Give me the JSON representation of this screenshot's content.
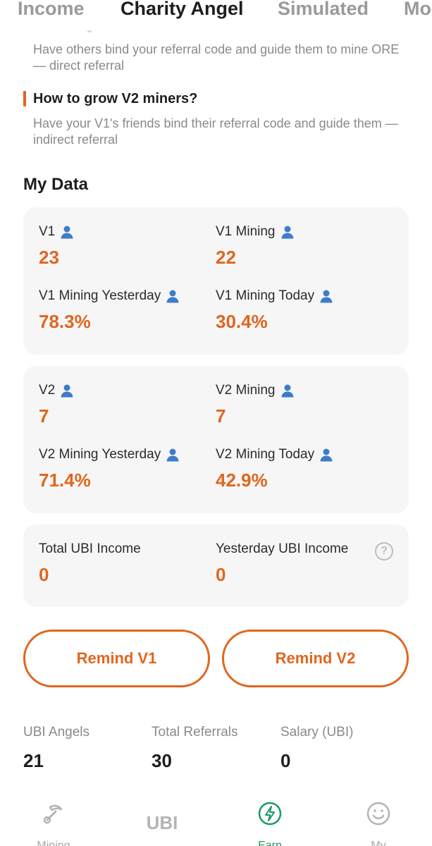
{
  "tabs": [
    "Income",
    "Charity Angel",
    "Simulated",
    "Mo"
  ],
  "intro": {
    "v1_desc": "Have others bind your referral code and guide them to mine ORE — direct referral",
    "v2_heading": "How to grow V2 miners?",
    "v2_desc": "Have your V1's friends bind their referral code and guide them — indirect referral"
  },
  "my_data": {
    "title": "My Data",
    "v1": {
      "count_label": "V1",
      "count": "23",
      "mining_label": "V1 Mining",
      "mining": "22",
      "yesterday_label": "V1 Mining Yesterday",
      "yesterday": "78.3%",
      "today_label": "V1 Mining Today",
      "today": "30.4%"
    },
    "v2": {
      "count_label": "V2",
      "count": "7",
      "mining_label": "V2 Mining",
      "mining": "7",
      "yesterday_label": "V2 Mining Yesterday",
      "yesterday": "71.4%",
      "today_label": "V2 Mining Today",
      "today": "42.9%"
    },
    "ubi": {
      "total_label": "Total UBI Income",
      "total": "0",
      "yesterday_label": "Yesterday UBI Income",
      "yesterday": "0",
      "help_glyph": "?"
    }
  },
  "buttons": {
    "remind_v1": "Remind V1",
    "remind_v2": "Remind V2"
  },
  "stats": {
    "angels_label": "UBI Angels",
    "angels": "21",
    "referrals_label": "Total Referrals",
    "referrals": "30",
    "salary_label": "Salary (UBI)",
    "salary": "0"
  },
  "bottom_nav": {
    "mining": "Mining",
    "ubi": "UBI",
    "earn": "Earn",
    "my": "My"
  },
  "colors": {
    "accent": "#e0661e",
    "person_icon": "#3d7cc9",
    "active_nav": "#1b9a62"
  },
  "icons": {
    "person": "person-icon",
    "help": "help-icon",
    "mining": "pickaxe-icon",
    "earn": "lightning-icon",
    "my": "smiley-icon"
  }
}
